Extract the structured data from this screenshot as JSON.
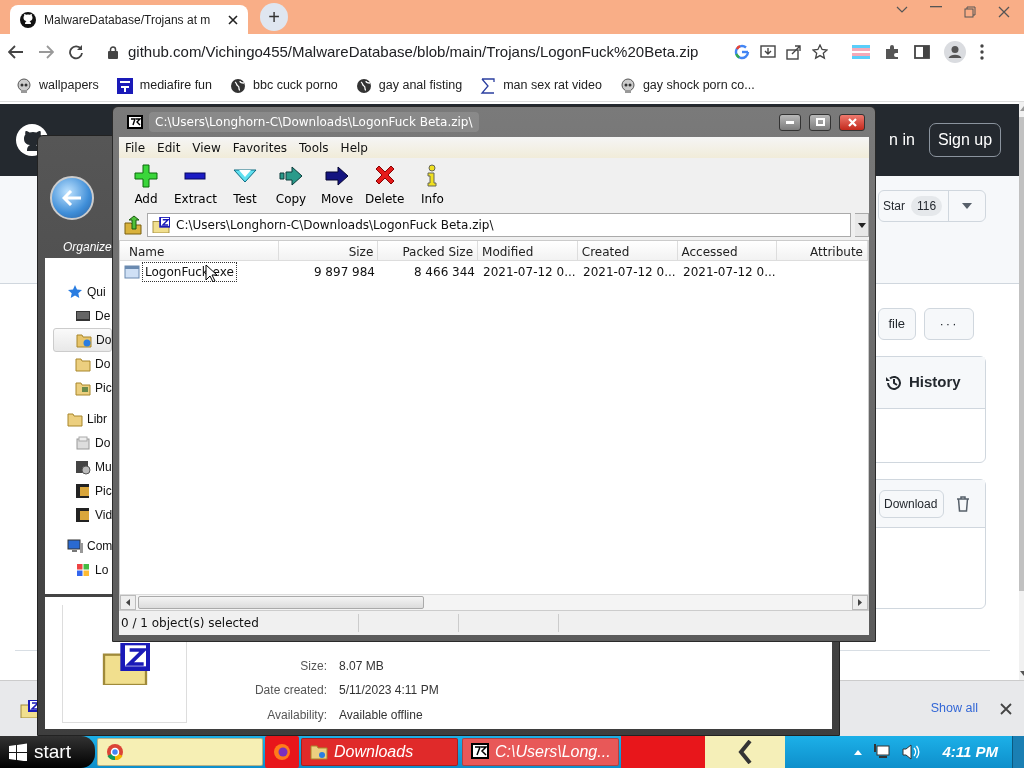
{
  "browser": {
    "tabs": [
      {
        "title": "MalwareDatabase/Trojans at m",
        "selected": true
      }
    ],
    "new_tab": "+",
    "url": "github.com/Vichingo455/MalwareDatabase/blob/main/Trojans/LogonFuck%20Beta.zip",
    "bookmarks": [
      {
        "label": "wallpapers",
        "kind": "skull"
      },
      {
        "label": "mediafire fun",
        "kind": "mf"
      },
      {
        "label": "bbc cuck porno",
        "kind": "globe"
      },
      {
        "label": "gay anal fisting",
        "kind": "globe"
      },
      {
        "label": "man sex rat video",
        "kind": "sigma"
      },
      {
        "label": "gay shock porn co...",
        "kind": "skull"
      }
    ]
  },
  "github": {
    "sign_in": "n in",
    "sign_up": "Sign up",
    "star_label": "Star",
    "star_count": "116",
    "file_button": "file",
    "more_button": "···",
    "history": "History",
    "download_button": "Download"
  },
  "downloads_bar": {
    "show_all": "Show all"
  },
  "explorer": {
    "organize": "Organize",
    "nav": [
      {
        "label": "Qui",
        "kind": "star",
        "selected": false,
        "children": [
          {
            "label": "De",
            "kind": "desktop",
            "selected": false
          },
          {
            "label": "Do",
            "kind": "download",
            "selected": true
          },
          {
            "label": "Do",
            "kind": "folder",
            "selected": false
          },
          {
            "label": "Pic",
            "kind": "pictures",
            "selected": false
          }
        ]
      },
      {
        "label": "Libr",
        "kind": "folder",
        "selected": false,
        "children": [
          {
            "label": "Do",
            "kind": "docs",
            "selected": false
          },
          {
            "label": "Mu",
            "kind": "music",
            "selected": false
          },
          {
            "label": "Pic",
            "kind": "film",
            "selected": false
          },
          {
            "label": "Vid",
            "kind": "film",
            "selected": false
          }
        ]
      },
      {
        "label": "Com",
        "kind": "computer",
        "selected": false,
        "children": [
          {
            "label": "Lo",
            "kind": "windows",
            "selected": false
          }
        ]
      }
    ],
    "details": [
      {
        "label": "Size:",
        "value": "8.07 MB"
      },
      {
        "label": "Date created:",
        "value": "5/11/2023 4:11 PM"
      },
      {
        "label": "Availability:",
        "value": "Available offline"
      }
    ]
  },
  "sevenzip": {
    "title": "C:\\Users\\Longhorn-C\\Downloads\\LogonFuck Beta.zip\\",
    "menu": [
      "File",
      "Edit",
      "View",
      "Favorites",
      "Tools",
      "Help"
    ],
    "tools": [
      {
        "label": "Add",
        "kind": "add"
      },
      {
        "label": "Extract",
        "kind": "extract"
      },
      {
        "label": "Test",
        "kind": "test"
      },
      {
        "label": "Copy",
        "kind": "copy"
      },
      {
        "label": "Move",
        "kind": "move"
      },
      {
        "label": "Delete",
        "kind": "delete"
      },
      {
        "label": "Info",
        "kind": "info"
      }
    ],
    "path": "C:\\Users\\Longhorn-C\\Downloads\\LogonFuck Beta.zip\\",
    "columns": [
      "Name",
      "Size",
      "Packed Size",
      "Modified",
      "Created",
      "Accessed",
      "Attribute"
    ],
    "rows": [
      {
        "cells": [
          "LogonFuck.exe",
          "9 897 984",
          "8 466 344",
          "2021-07-12 0...",
          "2021-07-12 0...",
          "2021-07-12 0..."
        ],
        "focused": true
      }
    ],
    "status": "0 / 1 object(s) selected"
  },
  "taskbar": {
    "start": "start",
    "tasks": [
      {
        "kind": "chrome",
        "color": "#f6efb4"
      },
      {
        "kind": "firefox",
        "color": "#e8161b"
      },
      {
        "kind": "explorer",
        "label": "Downloads",
        "color": "#e02a2a"
      },
      {
        "kind": "sevenzip",
        "label": "C:\\Users\\Long...",
        "color": "#e85858"
      }
    ],
    "clock": "4:11 PM"
  }
}
